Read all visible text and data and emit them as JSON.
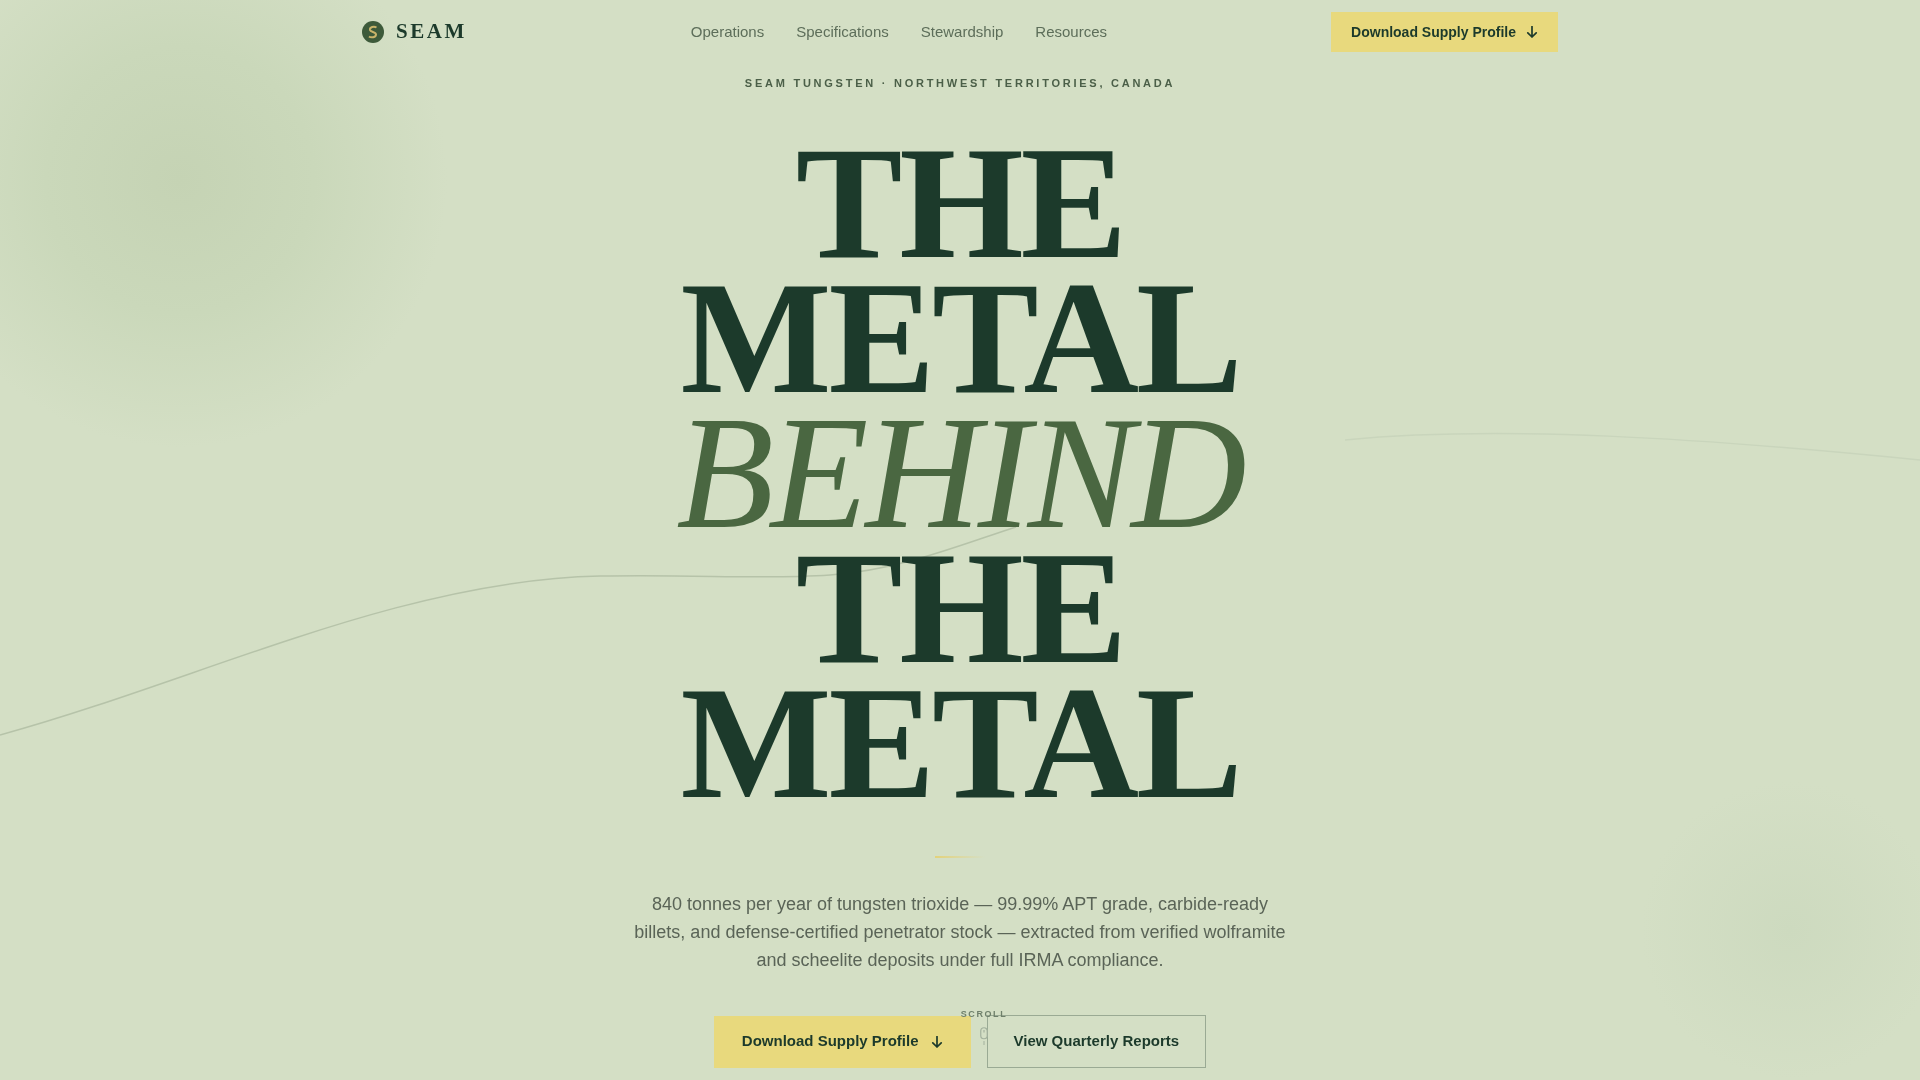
{
  "nav": {
    "logo": "SEAM",
    "links": [
      "Operations",
      "Specifications",
      "Stewardship",
      "Resources"
    ],
    "cta": "Download Supply Profile"
  },
  "hero": {
    "eyebrow": "SEAM TUNGSTEN · NORTHWEST TERRITORIES, CANADA",
    "headline": [
      {
        "text": "THE",
        "kind": "roman"
      },
      {
        "text": "METAL",
        "kind": "roman"
      },
      {
        "text": "BEHIND",
        "kind": "italic"
      },
      {
        "text": "THE",
        "kind": "roman"
      },
      {
        "text": "METAL",
        "kind": "roman"
      }
    ],
    "lede": "840 tonnes per year of tungsten trioxide — 99.99% APT grade, carbide-ready billets, and defense-certified penetrator stock — extracted from verified wolframite and scheelite deposits under full IRMA compliance.",
    "buttons": [
      {
        "label": "Download Supply Profile",
        "kind": "primary"
      },
      {
        "label": "View Quarterly Reports",
        "kind": "secondary"
      }
    ],
    "scroll_hint": "SCROLL"
  }
}
